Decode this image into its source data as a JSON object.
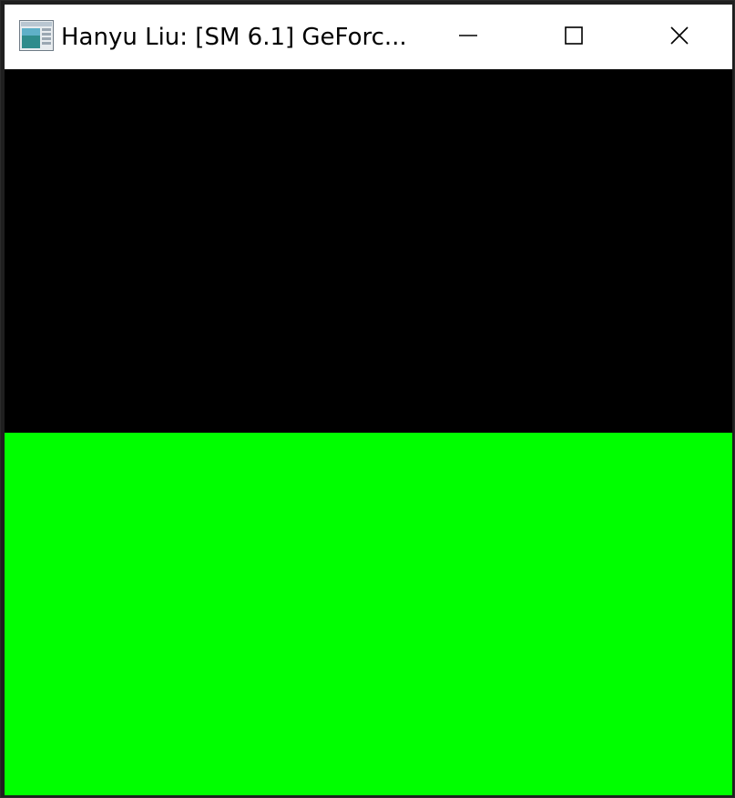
{
  "window": {
    "title": "Hanyu Liu: [SM 6.1] GeForc...",
    "app_icon": "application-window-icon",
    "controls": {
      "minimize_icon": "minimize-icon",
      "maximize_icon": "maximize-icon",
      "close_icon": "close-icon"
    }
  },
  "canvas": {
    "top_color": "#000000",
    "bottom_color": "#00ff00"
  }
}
